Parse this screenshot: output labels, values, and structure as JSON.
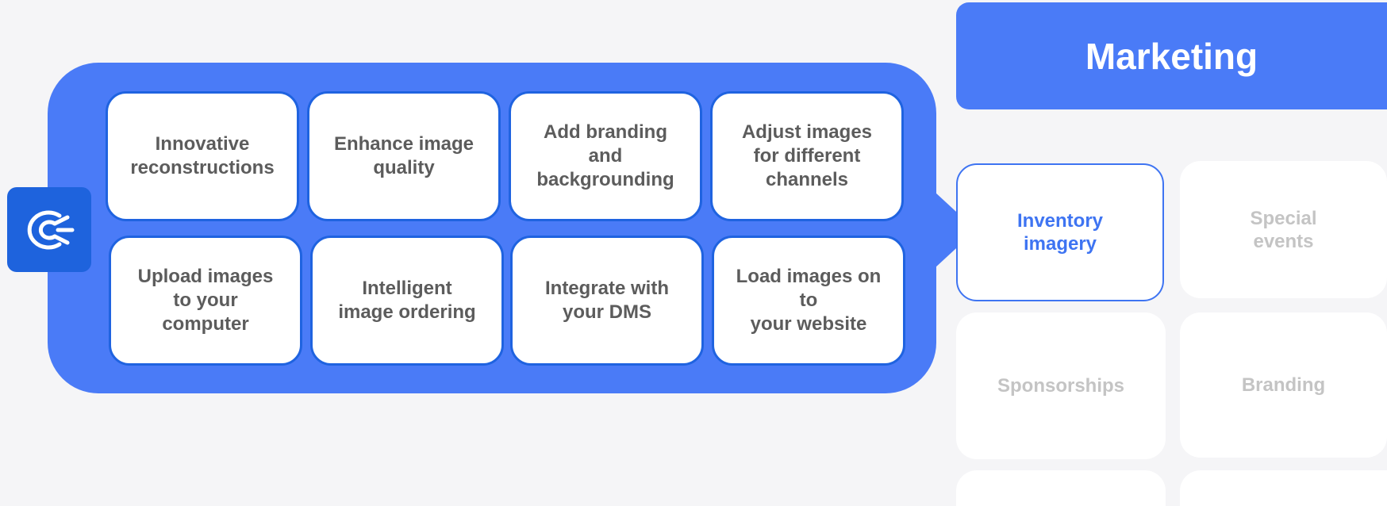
{
  "features": {
    "row1": [
      "Innovative\nreconstructions",
      "Enhance image\nquality",
      "Add branding\nand\nbackgrounding",
      "Adjust images\nfor different\nchannels"
    ],
    "row2": [
      "Upload images\nto your\ncomputer",
      "Intelligent\nimage ordering",
      "Integrate with\nyour DMS",
      "Load images on\nto\nyour website"
    ]
  },
  "marketing": {
    "title": "Marketing",
    "categories": [
      "Inventory\nimagery",
      "Special\nevents",
      "Sponsorships",
      "Branding",
      "",
      ""
    ],
    "active_index": 0
  },
  "colors": {
    "panel_blue": "#4a7bf7",
    "card_border": "#1f63e0",
    "logo_bg": "#1e63dd",
    "muted_text": "#c4c4c4",
    "card_text": "#5c5c5c"
  },
  "icons": {
    "logo": "brand-logo-icon"
  }
}
